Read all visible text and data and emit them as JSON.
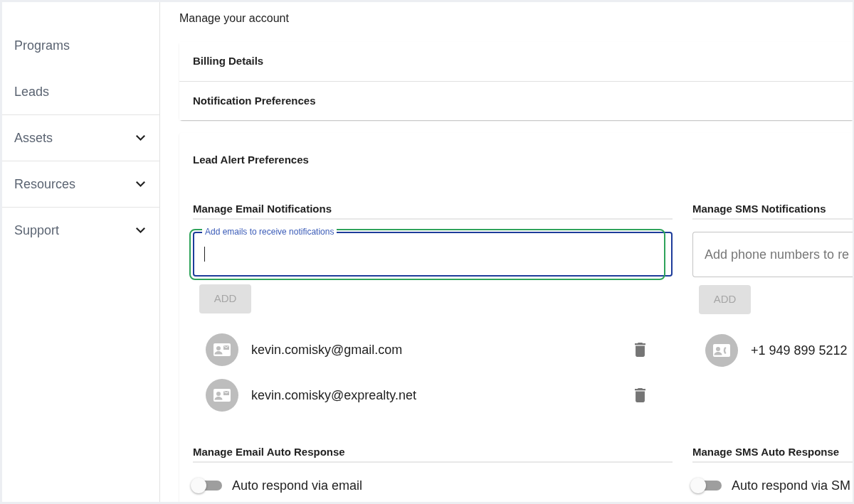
{
  "sidebar": {
    "items": [
      {
        "label": "Programs",
        "kind": "link"
      },
      {
        "label": "Leads",
        "kind": "link"
      },
      {
        "label": "Assets",
        "kind": "group"
      },
      {
        "label": "Resources",
        "kind": "group"
      },
      {
        "label": "Support",
        "kind": "group"
      }
    ]
  },
  "page": {
    "subtitle": "Manage your account"
  },
  "sections": [
    {
      "title": "Billing Details"
    },
    {
      "title": "Notification Preferences"
    }
  ],
  "lead_alert_preferences": {
    "title": "Lead Alert Preferences",
    "email_notifications": {
      "heading": "Manage Email Notifications",
      "field": {
        "label": "Add emails to receive notifications",
        "focused": true,
        "highlighted": true
      },
      "add_button": {
        "label": "ADD",
        "disabled": true
      },
      "contacts": [
        {
          "kind": "email",
          "address": "kevin.comisky@gmail.com",
          "deletable": true
        },
        {
          "kind": "email",
          "address": "kevin.comisky@exprealty.net",
          "deletable": true
        }
      ]
    },
    "sms_notifications": {
      "heading": "Manage SMS Notifications",
      "field": {
        "placeholder": "Add phone numbers to re",
        "focused": false,
        "highlighted": false
      },
      "add_button": {
        "label": "ADD",
        "disabled": true
      },
      "contacts": [
        {
          "kind": "phone",
          "address": "+1 949 899 5212",
          "deletable": false
        }
      ]
    },
    "email_auto_response": {
      "heading": "Manage Email Auto Response",
      "toggle": {
        "label": "Auto respond via email",
        "on": false
      }
    },
    "sms_auto_response": {
      "heading": "Manage SMS Auto Response",
      "toggle": {
        "label": "Auto respond via SM",
        "on": false
      }
    }
  }
}
